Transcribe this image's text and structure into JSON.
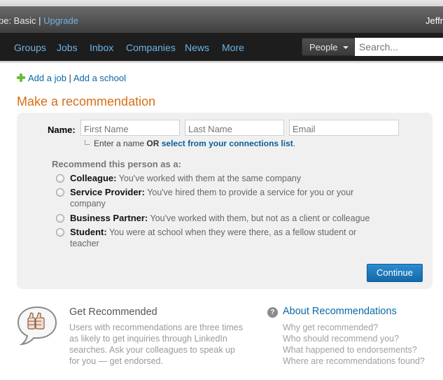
{
  "header": {
    "account_type_text": "pe: Basic | ",
    "upgrade_label": "Upgrade",
    "user_name": "Jeffr"
  },
  "nav": {
    "items": [
      {
        "label": "Groups"
      },
      {
        "label": "Jobs"
      },
      {
        "label": "Inbox"
      },
      {
        "label": "Companies"
      },
      {
        "label": "News"
      },
      {
        "label": "More"
      }
    ],
    "search_scope": "People",
    "search_placeholder": "Search..."
  },
  "add_links": {
    "add_job": "Add a job",
    "separator": " | ",
    "add_school": "Add a school"
  },
  "page_title": "Make a recommendation",
  "form": {
    "name_label": "Name:",
    "first_name_placeholder": "First Name",
    "last_name_placeholder": "Last Name",
    "email_placeholder": "Email",
    "hint_prefix": "Enter a name ",
    "hint_or": "OR",
    "hint_link": "select from your connections list",
    "hint_suffix": ".",
    "recommend_label": "Recommend this person as a:",
    "options": [
      {
        "title": "Colleague:",
        "desc": " You've worked with them at the same company",
        "selected": false
      },
      {
        "title": "Service Provider:",
        "desc": " You've hired them to provide a service for you or your company",
        "selected": false
      },
      {
        "title": "Business Partner:",
        "desc": " You've worked with them, but not as a client or colleague",
        "selected": false
      },
      {
        "title": "Student:",
        "desc": " You were at school when they were there, as a fellow student or teacher",
        "selected": false
      }
    ],
    "continue_label": "Continue"
  },
  "get_recommended": {
    "title": "Get Recommended",
    "body": "Users with recommendations are three times as likely to get inquiries through LinkedIn searches. Ask your colleagues to speak up for you — get endorsed."
  },
  "about": {
    "title": "About Recommendations",
    "links": [
      "Why get recommended?",
      "Who should recommend you?",
      "What happened to endorsements?",
      "Where are recommendations found?"
    ]
  },
  "colors": {
    "title_orange": "#d66f13",
    "link_blue": "#0a68a8",
    "nav_link": "#6fb3e6",
    "button_blue": "#1f7bbd"
  }
}
